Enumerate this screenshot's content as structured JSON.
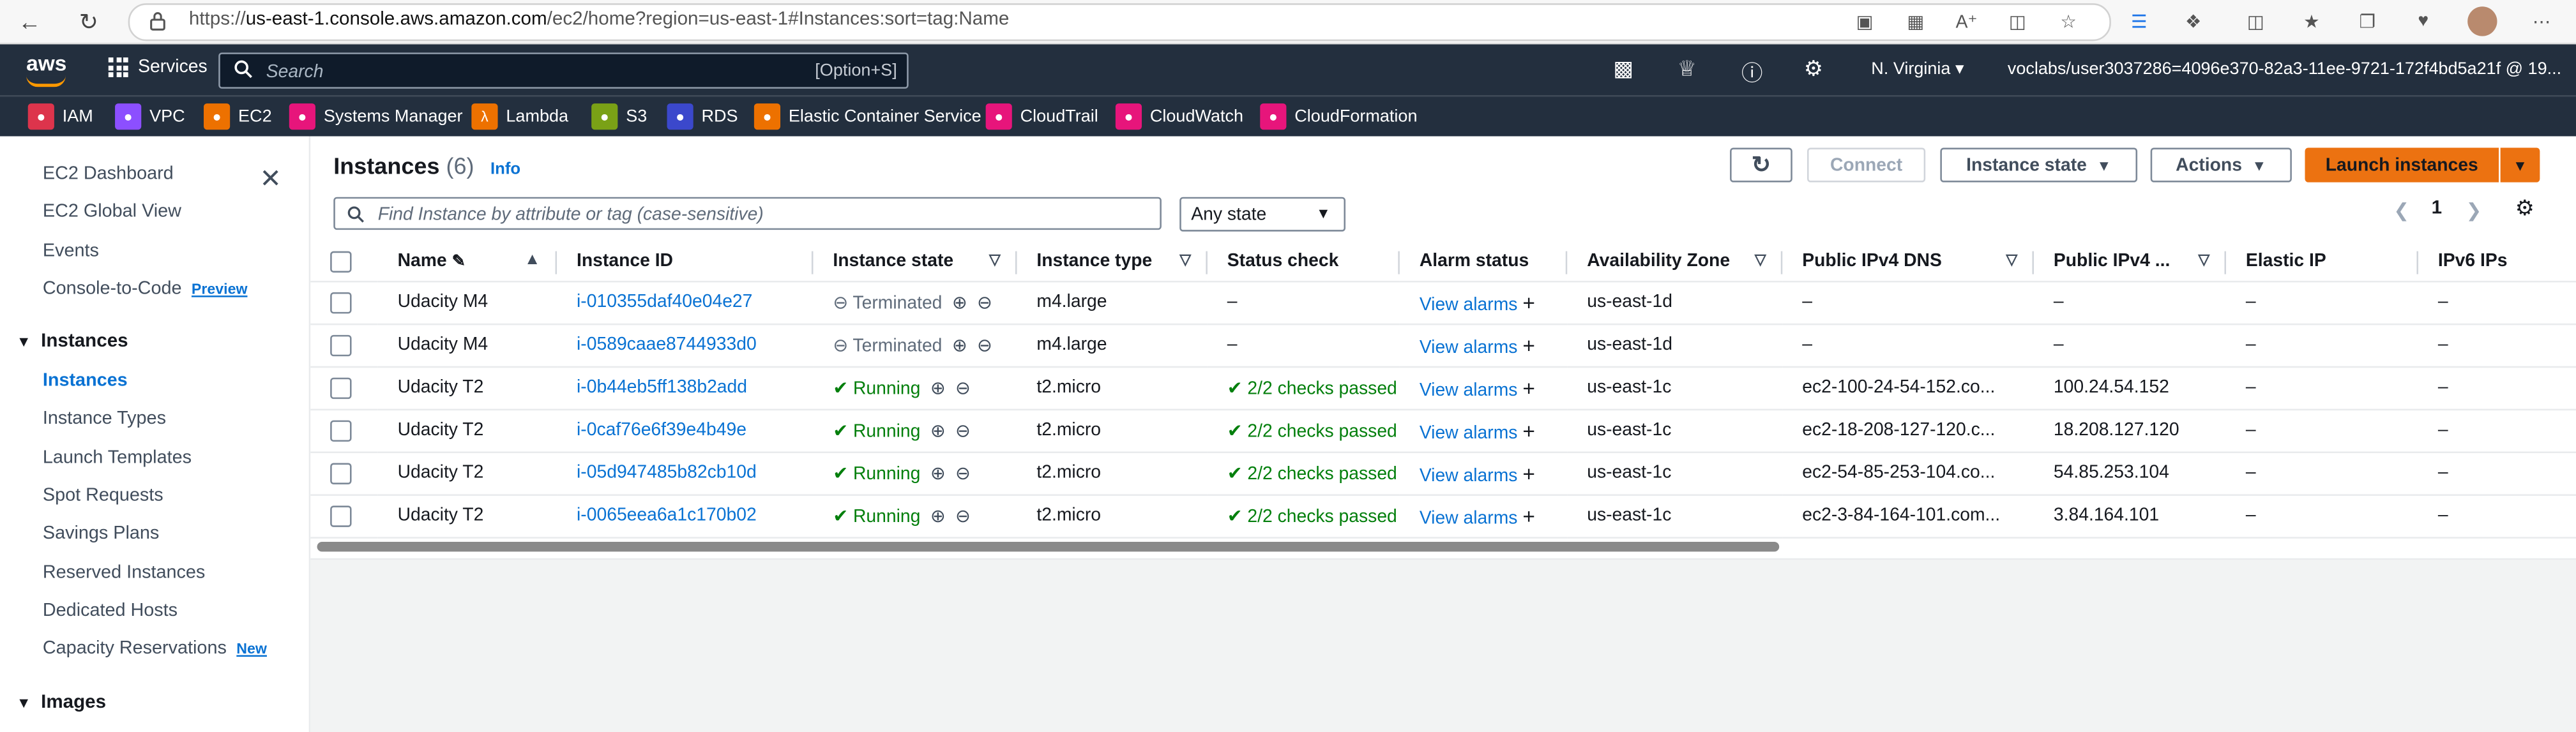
{
  "browser": {
    "url_prefix": "https://",
    "url_host": "us-east-1.console.aws.amazon.com",
    "url_path": "/ec2/home?region=us-east-1#Instances:sort=tag:Name"
  },
  "awsbar": {
    "logo": "aws",
    "services_label": "Services",
    "search_placeholder": "Search",
    "search_hint": "[Option+S]",
    "region": "N. Virginia",
    "account": "voclabs/user3037286=4096e370-82a3-11ee-9721-172f4bd5a21f @ 19..."
  },
  "favorites": [
    {
      "label": "IAM",
      "color": "#dd344c"
    },
    {
      "label": "VPC",
      "color": "#8c4fff"
    },
    {
      "label": "EC2",
      "color": "#ed7100"
    },
    {
      "label": "Systems Manager",
      "color": "#e7157b"
    },
    {
      "label": "Lambda",
      "color": "#ed7100"
    },
    {
      "label": "S3",
      "color": "#7aa116"
    },
    {
      "label": "RDS",
      "color": "#3b48cc"
    },
    {
      "label": "Elastic Container Service",
      "color": "#ed7100"
    },
    {
      "label": "CloudTrail",
      "color": "#e7157b"
    },
    {
      "label": "CloudWatch",
      "color": "#e7157b"
    },
    {
      "label": "CloudFormation",
      "color": "#e7157b"
    }
  ],
  "sidebar": {
    "items": [
      {
        "label": "EC2 Dashboard"
      },
      {
        "label": "EC2 Global View"
      },
      {
        "label": "Events"
      },
      {
        "label": "Console-to-Code",
        "badge": "Preview"
      }
    ],
    "section_instances": "Instances",
    "instances_items": [
      {
        "label": "Instances"
      },
      {
        "label": "Instance Types"
      },
      {
        "label": "Launch Templates"
      },
      {
        "label": "Spot Requests"
      },
      {
        "label": "Savings Plans"
      },
      {
        "label": "Reserved Instances"
      },
      {
        "label": "Dedicated Hosts"
      },
      {
        "label": "Capacity Reservations",
        "badge": "New"
      }
    ],
    "section_images": "Images"
  },
  "main": {
    "title": "Instances",
    "count": "(6)",
    "info": "Info",
    "connect_label": "Connect",
    "instance_state_label": "Instance state",
    "actions_label": "Actions",
    "launch_label": "Launch instances",
    "filter_placeholder": "Find Instance by attribute or tag (case-sensitive)",
    "state_filter": "Any state",
    "page": "1"
  },
  "table": {
    "columns": [
      "Name",
      "Instance ID",
      "Instance state",
      "Instance type",
      "Status check",
      "Alarm status",
      "Availability Zone",
      "Public IPv4 DNS",
      "Public IPv4 ...",
      "Elastic IP",
      "IPv6 IPs"
    ],
    "rows": [
      {
        "name": "Udacity M4",
        "id": "i-010355daf40e04e27",
        "state": "Terminated",
        "type": "m4.large",
        "check": "–",
        "alarm": "View alarms",
        "az": "us-east-1d",
        "dns": "–",
        "ip": "–",
        "eip": "–",
        "ipv6": "–"
      },
      {
        "name": "Udacity M4",
        "id": "i-0589caae8744933d0",
        "state": "Terminated",
        "type": "m4.large",
        "check": "–",
        "alarm": "View alarms",
        "az": "us-east-1d",
        "dns": "–",
        "ip": "–",
        "eip": "–",
        "ipv6": "–"
      },
      {
        "name": "Udacity T2",
        "id": "i-0b44eb5ff138b2add",
        "state": "Running",
        "type": "t2.micro",
        "check": "2/2 checks passed",
        "alarm": "View alarms",
        "az": "us-east-1c",
        "dns": "ec2-100-24-54-152.co...",
        "ip": "100.24.54.152",
        "eip": "–",
        "ipv6": "–"
      },
      {
        "name": "Udacity T2",
        "id": "i-0caf76e6f39e4b49e",
        "state": "Running",
        "type": "t2.micro",
        "check": "2/2 checks passed",
        "alarm": "View alarms",
        "az": "us-east-1c",
        "dns": "ec2-18-208-127-120.c...",
        "ip": "18.208.127.120",
        "eip": "–",
        "ipv6": "–"
      },
      {
        "name": "Udacity T2",
        "id": "i-05d947485b82cb10d",
        "state": "Running",
        "type": "t2.micro",
        "check": "2/2 checks passed",
        "alarm": "View alarms",
        "az": "us-east-1c",
        "dns": "ec2-54-85-253-104.co...",
        "ip": "54.85.253.104",
        "eip": "–",
        "ipv6": "–"
      },
      {
        "name": "Udacity T2",
        "id": "i-0065eea6a1c170b02",
        "state": "Running",
        "type": "t2.micro",
        "check": "2/2 checks passed",
        "alarm": "View alarms",
        "az": "us-east-1c",
        "dns": "ec2-3-84-164-101.com...",
        "ip": "3.84.164.101",
        "eip": "–",
        "ipv6": "–"
      }
    ]
  }
}
